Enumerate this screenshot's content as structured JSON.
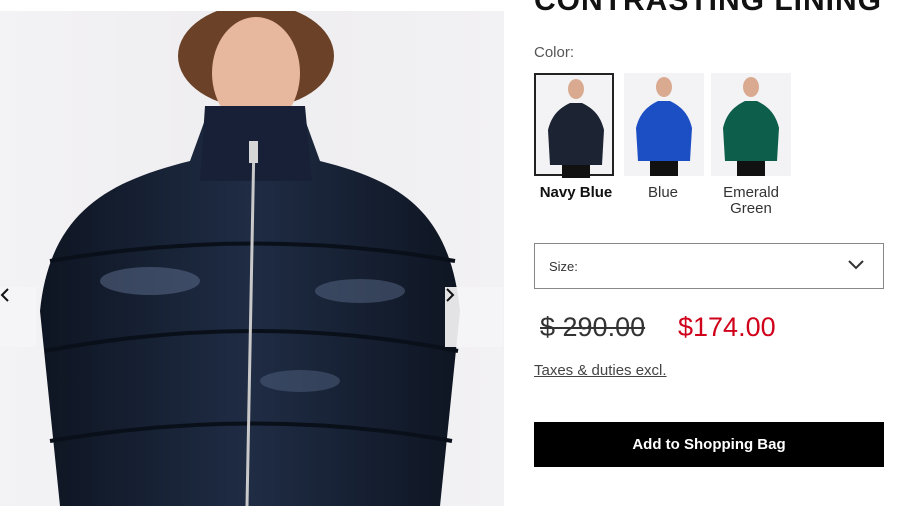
{
  "product": {
    "title": "CONTRASTING LINING",
    "color_label": "Color:",
    "colors": [
      {
        "name": "Navy Blue",
        "hex": "#1c2333",
        "selected": true
      },
      {
        "name": "Blue",
        "hex": "#1d4fc4",
        "selected": false
      },
      {
        "name": "Emerald Green",
        "hex": "#0e5e4c",
        "selected": false
      }
    ],
    "size_label": "Size:",
    "old_price": "$ 290.00",
    "new_price": "$174.00",
    "taxes_link": "Taxes & duties excl.",
    "add_button": "Add to Shopping Bag"
  },
  "gallery": {
    "prev_icon": "chevron-left-icon",
    "next_icon": "chevron-right-icon"
  },
  "colors": {
    "sale_red": "#d0021b",
    "button_black": "#000000"
  }
}
